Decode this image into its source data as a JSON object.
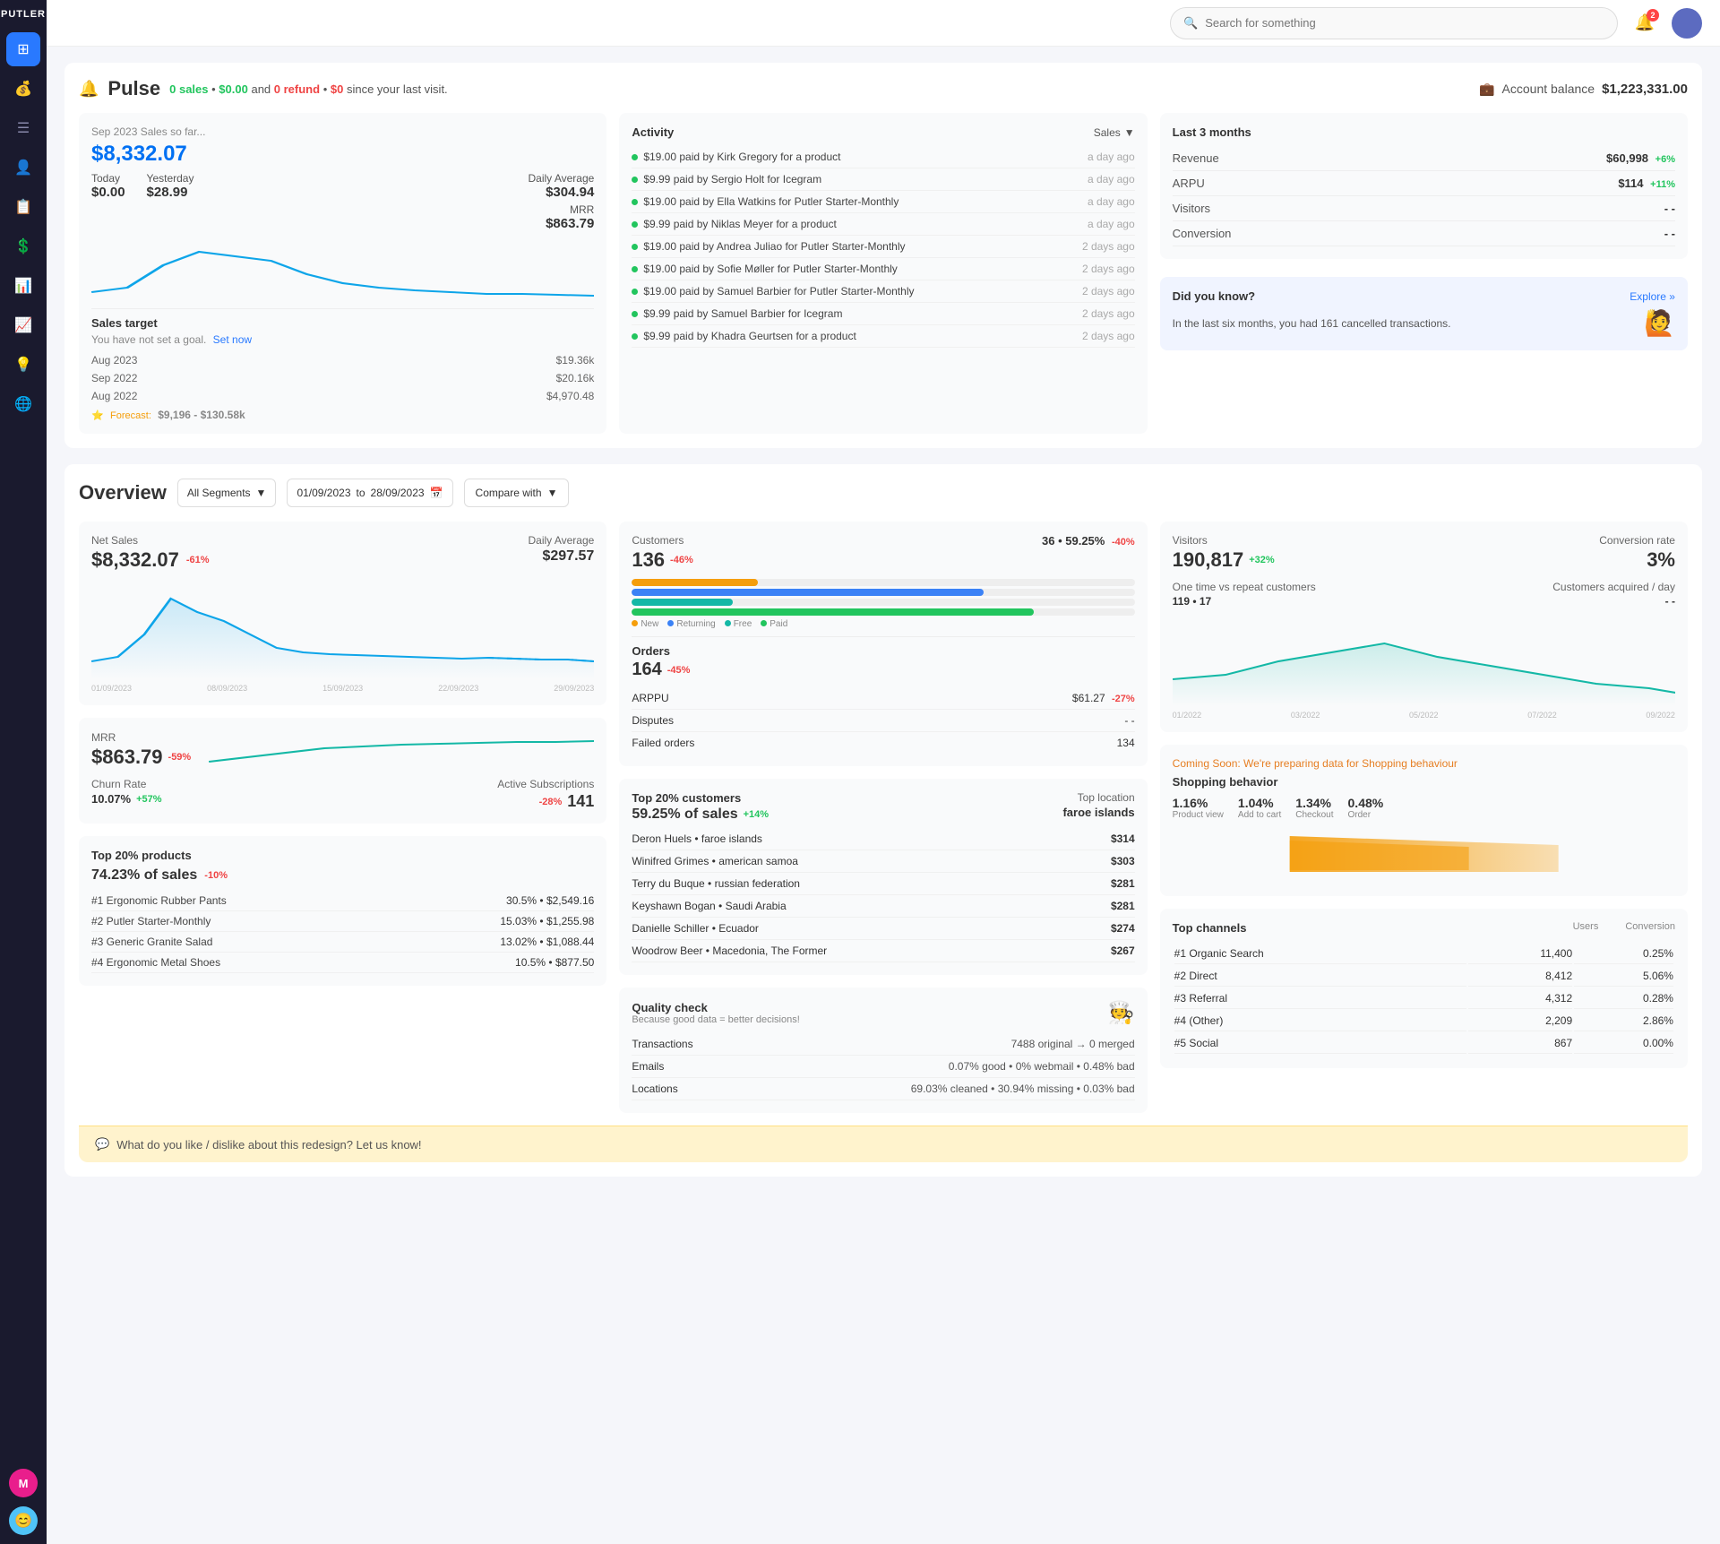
{
  "app": {
    "logo": "PUTLER"
  },
  "topbar": {
    "search_placeholder": "Search for something",
    "notif_count": "2"
  },
  "sidebar": {
    "items": [
      {
        "icon": "⊞",
        "name": "dashboard",
        "active": true
      },
      {
        "icon": "💰",
        "name": "revenue"
      },
      {
        "icon": "☰",
        "name": "orders"
      },
      {
        "icon": "👤",
        "name": "customers"
      },
      {
        "icon": "📋",
        "name": "subscriptions"
      },
      {
        "icon": "$",
        "name": "payouts"
      },
      {
        "icon": "📊",
        "name": "reports"
      },
      {
        "icon": "📈",
        "name": "trends"
      },
      {
        "icon": "💡",
        "name": "insights"
      },
      {
        "icon": "🌐",
        "name": "global"
      }
    ],
    "user1_label": "M",
    "user2_icon": "😊"
  },
  "pulse": {
    "title": "Pulse",
    "subtitle_prefix": "since your last visit.",
    "sales_count": "0 sales",
    "sales_amount": "$0.00",
    "refund_count": "0 refund",
    "refund_amount": "$0",
    "account_balance_label": "Account balance",
    "account_balance": "$1,223,331.00",
    "period": "Sep 2023 Sales so far...",
    "today_label": "Today",
    "today_val": "$0.00",
    "yesterday_label": "Yesterday",
    "yesterday_val": "$28.99",
    "main_value": "$8,332.07",
    "daily_avg_label": "Daily Average",
    "daily_avg_val": "$304.94",
    "mrr_label": "MRR",
    "mrr_val": "$863.79",
    "sales_target_label": "Sales target",
    "sales_target_msg": "You have not set a goal.",
    "set_now_label": "Set now",
    "targets": [
      {
        "period": "Aug 2023",
        "val": "$19.36k"
      },
      {
        "period": "Sep 2022",
        "val": "$20.16k"
      },
      {
        "period": "Aug 2022",
        "val": "$4,970.48"
      }
    ],
    "forecast_label": "Forecast:",
    "forecast_val": "$9,196 - $130.58k",
    "activity_title": "Activity",
    "sales_filter": "Sales",
    "activities": [
      {
        "text": "$19.00 paid by Kirk Gregory for a product",
        "time": "a day ago"
      },
      {
        "text": "$9.99 paid by Sergio Holt for Icegram",
        "time": "a day ago"
      },
      {
        "text": "$19.00 paid by Ella Watkins for Putler Starter-Monthly",
        "time": "a day ago"
      },
      {
        "text": "$9.99 paid by Niklas Meyer for a product",
        "time": "a day ago"
      },
      {
        "text": "$19.00 paid by Andrea Juliao for Putler Starter-Monthly",
        "time": "2 days ago"
      },
      {
        "text": "$19.00 paid by Sofie Møller for Putler Starter-Monthly",
        "time": "2 days ago"
      },
      {
        "text": "$19.00 paid by Samuel Barbier for Putler Starter-Monthly",
        "time": "2 days ago"
      },
      {
        "text": "$9.99 paid by Samuel Barbier for Icegram",
        "time": "2 days ago"
      },
      {
        "text": "$9.99 paid by Khadra Geurtsen for a product",
        "time": "2 days ago"
      }
    ],
    "last3months_title": "Last 3 months",
    "revenue_label": "Revenue",
    "revenue_val": "$60,998",
    "revenue_change": "+6%",
    "arpu_label": "ARPU",
    "arpu_val": "$114",
    "arpu_change": "+11%",
    "visitors_label": "Visitors",
    "visitors_val": "- -",
    "conversion_label": "Conversion",
    "conversion_val": "- -",
    "dyk_title": "Did you know?",
    "explore_label": "Explore »",
    "dyk_text": "In the last six months, you had 161 cancelled transactions."
  },
  "overview": {
    "title": "Overview",
    "segment_label": "All Segments",
    "date_from": "01/09/2023",
    "date_to": "28/09/2023",
    "compare_label": "Compare with",
    "net_sales_label": "Net Sales",
    "net_sales_val": "$8,332.07",
    "net_sales_change": "-61%",
    "daily_avg_label": "Daily Average",
    "daily_avg_val": "$297.57",
    "chart_dates": [
      "01/09/2023",
      "08/09/2023",
      "15/09/2023",
      "22/09/2023",
      "29/09/2023"
    ],
    "customers_label": "Customers",
    "customers_val": "136",
    "customers_change": "-46%",
    "customers_36": "36",
    "customers_pct": "59.25%",
    "customers_pct_change": "-40%",
    "orders_label": "Orders",
    "orders_val": "164",
    "orders_change": "-45%",
    "bar_new_pct": 25,
    "bar_returning_pct": 70,
    "bar_free_pct": 15,
    "bar_paid_pct": 80,
    "arppu_label": "ARPPU",
    "arppu_val": "$61.27",
    "arppu_change": "-27%",
    "disputes_label": "Disputes",
    "disputes_val": "- -",
    "failed_orders_label": "Failed orders",
    "failed_orders_val": "134",
    "top20_label": "Top 20% customers",
    "top20_pct": "59.25% of sales",
    "top20_change": "+14%",
    "top_location_label": "Top location",
    "top_location_val": "faroe islands",
    "top_customers": [
      {
        "name": "Deron Huels • faroe islands",
        "val": "$314"
      },
      {
        "name": "Winifred Grimes • american samoa",
        "val": "$303"
      },
      {
        "name": "Terry du Buque • russian federation",
        "val": "$281"
      },
      {
        "name": "Keyshawn Bogan • Saudi Arabia",
        "val": "$281"
      },
      {
        "name": "Danielle Schiller • Ecuador",
        "val": "$274"
      },
      {
        "name": "Woodrow Beer • Macedonia, The Former",
        "val": "$267"
      }
    ],
    "mrr_label": "MRR",
    "mrr_val": "$863.79",
    "mrr_change": "-59%",
    "churn_label": "Churn Rate",
    "churn_val": "10.07%",
    "churn_change": "+57%",
    "active_subs_label": "Active Subscriptions",
    "active_subs_change": "-28%",
    "active_subs_val": "141",
    "top20_products_label": "Top 20% products",
    "top20_products_pct": "74.23% of sales",
    "top20_products_change": "-10%",
    "products": [
      {
        "name": "#1 Ergonomic Rubber Pants",
        "val": "30.5% • $2,549.16"
      },
      {
        "name": "#2 Putler Starter-Monthly",
        "val": "15.03% • $1,255.98"
      },
      {
        "name": "#3 Generic Granite Salad",
        "val": "13.02% • $1,088.44"
      },
      {
        "name": "#4 Ergonomic Metal Shoes",
        "val": "10.5% • $877.50"
      }
    ],
    "visitors_label": "Visitors",
    "visitors_val": "190,817",
    "visitors_change": "+32%",
    "conversion_label": "Conversion rate",
    "conversion_val": "3%",
    "one_time_label": "One time vs repeat customers",
    "one_time_val": "119 • 17",
    "cust_per_day_label": "Customers acquired / day",
    "cust_per_day_val": "- -",
    "vis_dates": [
      "01/2022",
      "03/2022",
      "05/2022",
      "07/2022",
      "09/2022"
    ],
    "coming_soon_label": "Coming Soon: We're preparing data for Shopping behaviour",
    "shopping_behavior_label": "Shopping behavior",
    "shop_metrics": [
      {
        "val": "1.16%",
        "lbl": "Product view"
      },
      {
        "val": "1.04%",
        "lbl": "Add to cart"
      },
      {
        "val": "1.34%",
        "lbl": "Checkout"
      },
      {
        "val": "0.48%",
        "lbl": "Order"
      }
    ],
    "channels_label": "Top channels",
    "channels_users_lbl": "Users",
    "channels_conv_lbl": "Conversion",
    "channels": [
      {
        "name": "#1 Organic Search",
        "users": "11,400",
        "conv": "0.25%"
      },
      {
        "name": "#2 Direct",
        "users": "8,412",
        "conv": "5.06%"
      },
      {
        "name": "#3 Referral",
        "users": "4,312",
        "conv": "0.28%"
      },
      {
        "name": "#4 (Other)",
        "users": "2,209",
        "conv": "2.86%"
      },
      {
        "name": "#5 Social",
        "users": "867",
        "conv": "0.00%"
      }
    ],
    "quality_label": "Quality check",
    "quality_subtitle": "Because good data = better decisions!",
    "quality_rows": [
      {
        "label": "Transactions",
        "val": "7488 original → 0 merged"
      },
      {
        "label": "Emails",
        "val": "0.07% good • 0% webmail • 0.48% bad"
      },
      {
        "label": "Locations",
        "val": "69.03% cleaned • 30.94% missing • 0.03% bad"
      }
    ],
    "feedback_text": "What do you like / dislike about this redesign? Let us know!"
  }
}
